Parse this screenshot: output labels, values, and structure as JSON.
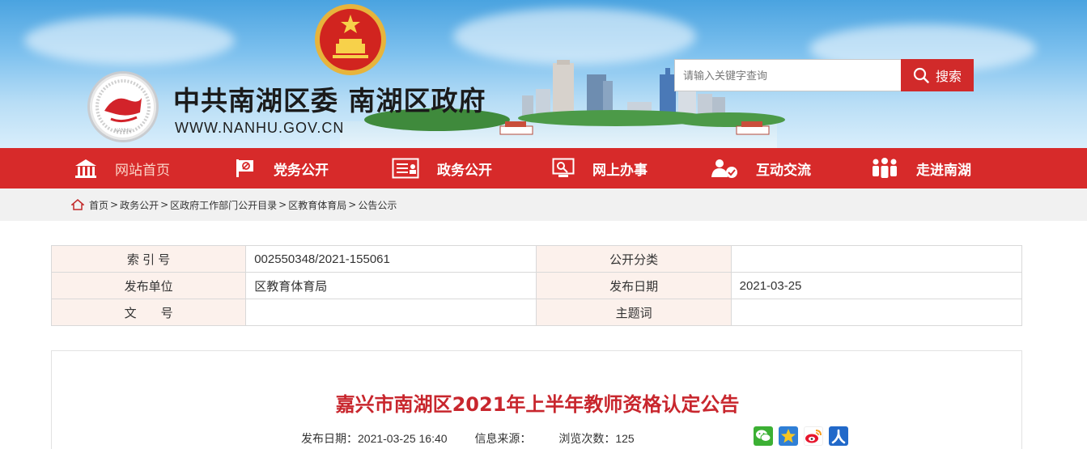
{
  "header": {
    "site_title": "中共南湖区委 南湖区政府",
    "site_url": "WWW.NANHU.GOV.CN",
    "logo_text": "NANHU"
  },
  "search": {
    "placeholder": "请输入关键字查询",
    "button_label": "搜索"
  },
  "nav": {
    "items": [
      {
        "label": "网站首页",
        "icon": "home-icon"
      },
      {
        "label": "党务公开",
        "icon": "party-flag-icon"
      },
      {
        "label": "政务公开",
        "icon": "document-icon"
      },
      {
        "label": "网上办事",
        "icon": "online-service-icon"
      },
      {
        "label": "互动交流",
        "icon": "interaction-icon"
      },
      {
        "label": "走进南湖",
        "icon": "people-icon"
      }
    ]
  },
  "breadcrumb": {
    "items": [
      "首页",
      "政务公开",
      "区政府工作部门公开目录",
      "区教育体育局",
      "公告公示"
    ],
    "separator": ">"
  },
  "info": {
    "rows": [
      {
        "k1": "索 引 号",
        "v1": "002550348/2021-155061",
        "k2": "公开分类",
        "v2": ""
      },
      {
        "k1": "发布单位",
        "v1": "区教育体育局",
        "k2": "发布日期",
        "v2": "2021-03-25"
      },
      {
        "k1": "文　　号",
        "v1": "",
        "k2": "主题词",
        "v2": ""
      }
    ]
  },
  "article": {
    "title": "嘉兴市南湖区2021年上半年教师资格认定公告",
    "date_label": "发布日期：2021-03-25 16:40",
    "source_label": "信息来源：",
    "views_label": "浏览次数：125"
  },
  "colors": {
    "nav_red": "#d72a2a",
    "title_red": "#c8262d",
    "table_key_bg": "#fcf1ec"
  }
}
